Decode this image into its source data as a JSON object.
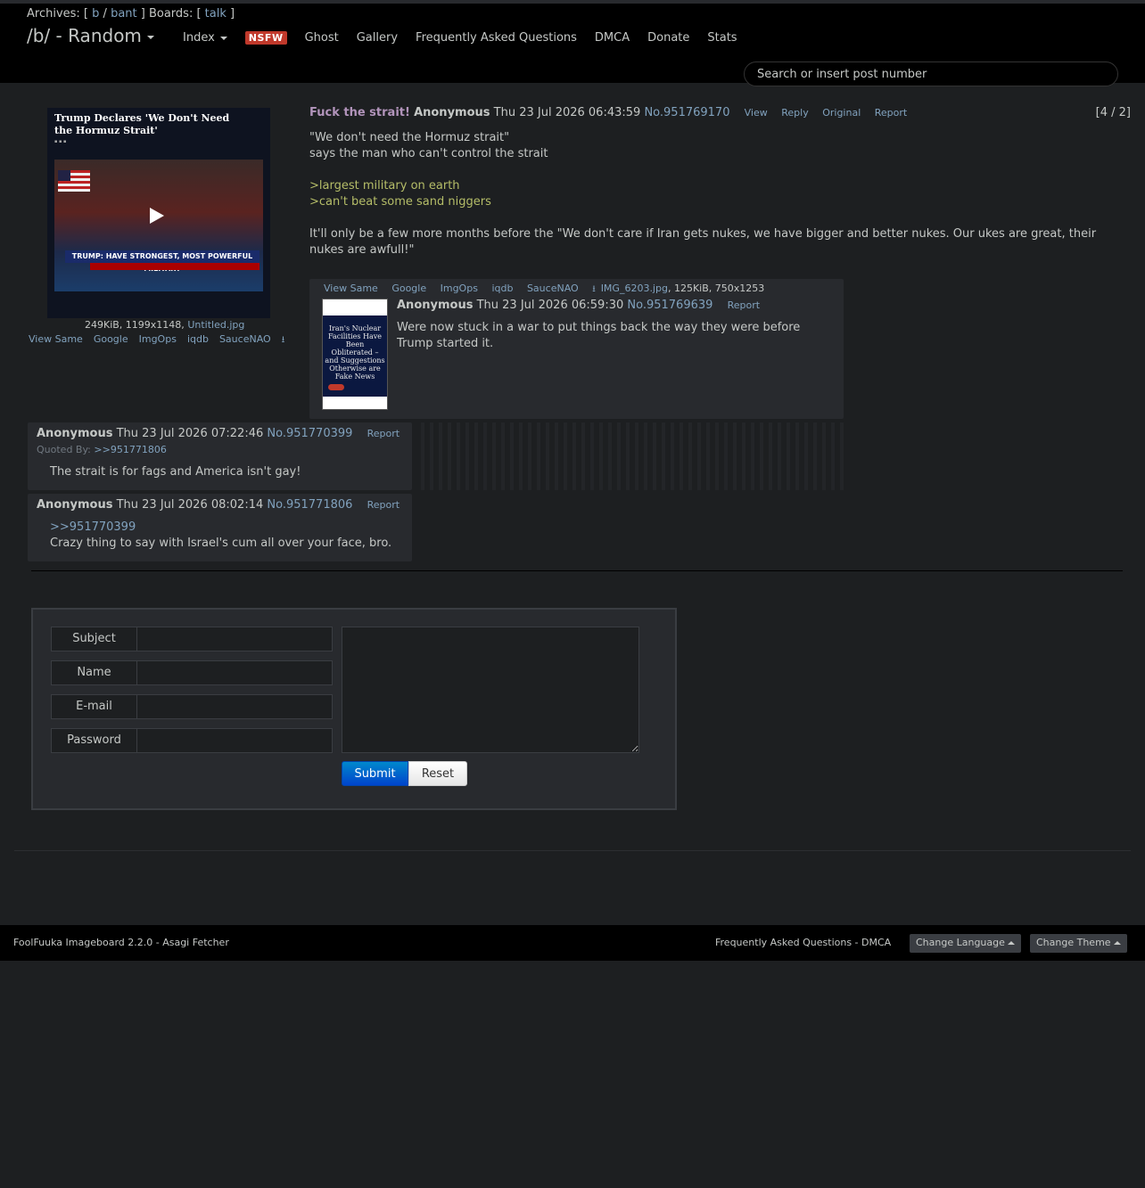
{
  "header": {
    "archives_label": "Archives: [",
    "archive_b": "b",
    "sep": " / ",
    "archive_bant": "bant",
    "boards_label": " ] Boards: [",
    "board_talk": "talk",
    "close_bracket": " ]",
    "board_title": "/b/ - Random",
    "nav": {
      "index": "Index",
      "nsfw": "NSFW",
      "ghost": "Ghost",
      "gallery": "Gallery",
      "faq": "Frequently Asked Questions",
      "dmca": "DMCA",
      "donate": "Donate",
      "stats": "Stats"
    },
    "search_placeholder": "Search or insert post number"
  },
  "op": {
    "thumb_headline": "Trump Declares 'We Don't Need the Hormuz Strait'",
    "thumb_lower_third": "TRUMP: HAVE STRONGEST, MOST POWERFUL MILITARY",
    "file_meta": "249KiB, 1199x1148,",
    "filename": "Untitled.jpg",
    "file_links": [
      "View Same",
      "Google",
      "ImgOps",
      "iqdb",
      "SauceNAO"
    ],
    "subject": "Fuck the strait!",
    "name": "Anonymous",
    "date": "Thu 23 Jul 2026 06:43:59",
    "postnum": "No.951769170",
    "actions": [
      "View",
      "Reply",
      "Original",
      "Report"
    ],
    "thread_count": "[4 / 2]",
    "body_line1": "\"We don't need the Hormuz strait\"",
    "body_line2": "says the man who can't control the strait",
    "greentext1": ">largest military on earth",
    "greentext2": ">can't beat some sand niggers",
    "body_line3": "It'll only be a few more months before the \"We don't care if Iran gets nukes, we have bigger and better nukes. Our ukes are great, their nukes are awfull!\""
  },
  "replies": [
    {
      "file_links": [
        "View Same",
        "Google",
        "ImgOps",
        "iqdb",
        "SauceNAO"
      ],
      "filename": "IMG_6203.jpg",
      "file_meta": ", 125KiB, 750x1253",
      "thumb_text": "Iran's Nuclear Facilities Have Been Obliterated – and Suggestions Otherwise are Fake News",
      "name": "Anonymous",
      "date": "Thu 23 Jul 2026 06:59:30",
      "postnum": "No.951769639",
      "report": "Report",
      "body": "Were now stuck in a war to put things back the way they were before Trump started it."
    },
    {
      "name": "Anonymous",
      "date": "Thu 23 Jul 2026 07:22:46",
      "postnum": "No.951770399",
      "report": "Report",
      "quoted_by_label": "Quoted By:",
      "quoted_by": ">>951771806",
      "body": "The strait is for fags and America isn't gay!"
    },
    {
      "name": "Anonymous",
      "date": "Thu 23 Jul 2026 08:02:14",
      "postnum": "No.951771806",
      "report": "Report",
      "quote": ">>951770399",
      "body": "Crazy thing to say with Israel's cum all over your face, bro."
    }
  ],
  "form": {
    "subject": "Subject",
    "name": "Name",
    "email": "E-mail",
    "password": "Password",
    "submit": "Submit",
    "reset": "Reset"
  },
  "footer": {
    "left": "FoolFuuka Imageboard 2.2.0 - Asagi Fetcher",
    "right": "Frequently Asked Questions - DMCA",
    "change_language": "Change Language",
    "change_theme": "Change Theme"
  }
}
